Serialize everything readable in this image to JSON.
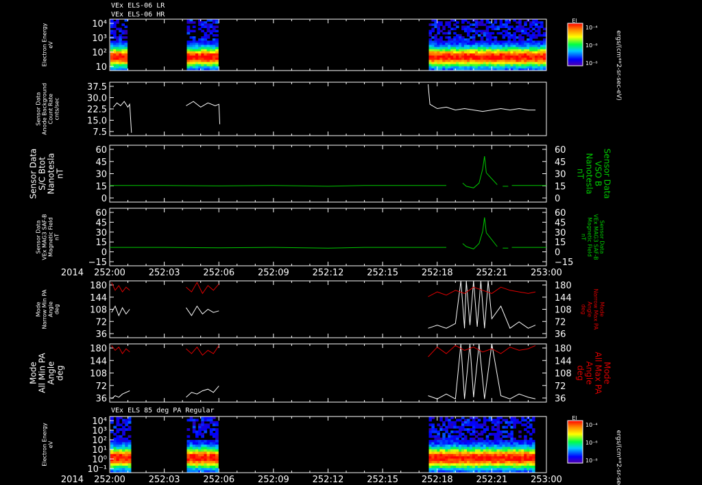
{
  "header": {
    "line1": "VEx ELS-06 LR",
    "line2": "VEx ELS-06 HR",
    "spectrogram2_title": "VEx ELS 85 deg PA Regular"
  },
  "colors": {
    "background": "#000000",
    "white_trace": "#ffffff",
    "green_trace": "#00cc00",
    "red_trace": "#dd0000",
    "right_label_green": "#00cc00",
    "right_label_red": "#dd0000"
  },
  "colorbars": [
    {
      "title": "El",
      "ticks": [
        "10⁻⁴",
        "10⁻⁶",
        "10⁻⁸"
      ],
      "unit": "ergs/(cm**2-sr-sec-eV)"
    },
    {
      "title": "El",
      "ticks": [
        "10⁻⁴",
        "10⁻⁶",
        "10⁻⁸"
      ],
      "unit": "ergs/(cm**2-sr-sec-eV)"
    }
  ],
  "x_axis": {
    "year_label": "2014",
    "ticks": [
      "252:00",
      "252:03",
      "252:06",
      "252:09",
      "252:12",
      "252:15",
      "252:18",
      "252:21",
      "253:00"
    ]
  },
  "chart_data": [
    {
      "type": "heatmap",
      "name": "electron-energy-spectrogram-1",
      "ylabel": [
        "Electron Energy",
        "eV"
      ],
      "yscale": "log",
      "yticks": [
        "10⁴",
        "10³",
        "10²",
        "10"
      ],
      "data_intervals_min": [
        [
          0,
          1.0
        ],
        [
          4.2,
          6.0
        ],
        [
          17.5,
          24
        ]
      ],
      "x_range_min": [
        0,
        24
      ]
    },
    {
      "type": "line",
      "name": "anode-background",
      "ylabel": [
        "Sensor Data",
        "Anode Background",
        "Count Rate",
        "cnts/sec"
      ],
      "yticks": [
        "37.5",
        "30.0",
        "22.5",
        "15.0",
        "7.5"
      ],
      "ylim": [
        0,
        37.5
      ],
      "series": [
        {
          "segments": [
            {
              "x": [
                0.2,
                0.4,
                0.6,
                0.8,
                1.0,
                1.1,
                1.2
              ],
              "y": [
                20,
                23,
                21,
                24,
                20,
                22,
                2
              ]
            },
            {
              "x": [
                4.2,
                4.6,
                5.0,
                5.4,
                5.8,
                6.0,
                6.05
              ],
              "y": [
                21,
                24,
                20,
                23,
                21,
                22,
                8
              ]
            },
            {
              "x": [
                17.5,
                17.6,
                18.0,
                18.5,
                19.0,
                19.5,
                20.0,
                20.5,
                21.0,
                21.5,
                22.0,
                22.5,
                23.0,
                23.4
              ],
              "y": [
                36,
                22,
                19,
                20,
                18,
                19,
                18,
                17,
                18,
                19,
                18,
                19,
                18,
                18
              ]
            }
          ]
        }
      ]
    },
    {
      "type": "line",
      "name": "sc-btot",
      "ylabel": [
        "Sensor Data",
        "S/C Btot",
        "Nanotesla",
        "nT"
      ],
      "yticks": [
        "60",
        "45",
        "30",
        "15",
        "0"
      ],
      "ylim": [
        -12,
        60
      ],
      "right_label": [
        "Sensor Data",
        "VSO B",
        "Nanotesla",
        "nT"
      ],
      "series": [
        {
          "segments": [
            {
              "x": [
                0,
                3,
                6,
                9,
                12,
                14,
                16,
                18.5
              ],
              "y": [
                9,
                9,
                8.5,
                9,
                8,
                9,
                9,
                9
              ]
            },
            {
              "x": [
                19.4,
                19.6,
                20.0,
                20.3,
                20.5,
                20.6,
                20.7
              ],
              "y": [
                12,
                8,
                6,
                12,
                30,
                46,
                25
              ]
            },
            {
              "x": [
                20.7,
                21.3
              ],
              "y": [
                25,
                10
              ]
            },
            {
              "x": [
                21.6,
                21.9
              ],
              "y": [
                8,
                8
              ]
            },
            {
              "x": [
                22.1,
                24
              ],
              "y": [
                9,
                9
              ]
            }
          ]
        }
      ]
    },
    {
      "type": "line",
      "name": "magnetic-field",
      "ylabel": [
        "Sensor Data",
        "VEx MAG3 SAF-B",
        "Magnetic Field",
        "nT"
      ],
      "yticks": [
        "60",
        "45",
        "30",
        "15",
        "0",
        "−15"
      ],
      "ylim": [
        -15,
        60
      ],
      "right_label": [
        "Sensor Data",
        "VEx MAG3 SAF-B",
        "Magnetic Field",
        "nT"
      ],
      "series": [
        {
          "segments": [
            {
              "x": [
                0,
                3,
                6,
                9,
                12,
                14,
                16,
                18.5
              ],
              "y": [
                9,
                9,
                8.5,
                9,
                8,
                9,
                9,
                9
              ]
            },
            {
              "x": [
                19.4,
                19.6,
                20.0,
                20.3,
                20.5,
                20.6,
                20.7
              ],
              "y": [
                14,
                10,
                7,
                14,
                30,
                48,
                28
              ]
            },
            {
              "x": [
                20.7,
                21.3
              ],
              "y": [
                28,
                10
              ]
            },
            {
              "x": [
                21.6,
                21.9
              ],
              "y": [
                8,
                8
              ]
            },
            {
              "x": [
                22.1,
                24
              ],
              "y": [
                9,
                9
              ]
            }
          ]
        }
      ]
    },
    {
      "type": "line",
      "name": "narrow-pa",
      "ylabel": [
        "Mode",
        "Narrow Min PA",
        "Angle",
        "deg"
      ],
      "yticks": [
        "180",
        "144",
        "108",
        "72",
        "36"
      ],
      "ylim": [
        0,
        180
      ],
      "right_label": [
        "Mode",
        "Narrow Max PA",
        "Angle",
        "deg"
      ],
      "series": [
        {
          "name": "min",
          "segments": [
            {
              "x": [
                0.1,
                0.3,
                0.5,
                0.7,
                0.9,
                1.1
              ],
              "y": [
                80,
                100,
                70,
                95,
                75,
                90
              ]
            },
            {
              "x": [
                4.2,
                4.5,
                4.8,
                5.1,
                5.4,
                5.7,
                6.0
              ],
              "y": [
                95,
                70,
                100,
                75,
                90,
                80,
                85
              ]
            },
            {
              "x": [
                17.5,
                18.0,
                18.5,
                19.0,
                19.3,
                19.5,
                19.6,
                19.8,
                20.0,
                20.2,
                20.4,
                20.6,
                20.8,
                21.0,
                21.5,
                22.0,
                22.5,
                23.0,
                23.4
              ],
              "y": [
                30,
                40,
                30,
                45,
                180,
                30,
                180,
                40,
                180,
                35,
                180,
                30,
                180,
                60,
                100,
                30,
                50,
                30,
                40
              ]
            }
          ]
        },
        {
          "name": "max",
          "segments": [
            {
              "x": [
                0.1,
                0.3,
                0.5,
                0.7,
                0.9,
                1.1
              ],
              "y": [
                175,
                150,
                165,
                145,
                160,
                150
              ]
            },
            {
              "x": [
                4.2,
                4.5,
                4.8,
                5.1,
                5.4,
                5.7,
                6.0
              ],
              "y": [
                160,
                145,
                175,
                140,
                165,
                150,
                170
              ]
            },
            {
              "x": [
                17.5,
                18.0,
                18.5,
                19.0,
                19.5,
                20.0,
                20.5,
                21.0,
                21.5,
                22.0,
                22.5,
                23.0,
                23.4
              ],
              "y": [
                130,
                145,
                135,
                150,
                140,
                160,
                150,
                140,
                160,
                150,
                145,
                140,
                145
              ]
            }
          ]
        }
      ]
    },
    {
      "type": "line",
      "name": "all-pa",
      "ylabel": [
        "Mode",
        "All Min PA",
        "Angle",
        "deg"
      ],
      "yticks": [
        "180",
        "144",
        "108",
        "72",
        "36"
      ],
      "ylim": [
        0,
        180
      ],
      "right_label": [
        "Mode",
        "All Max PA",
        "Angle",
        "deg"
      ],
      "series": [
        {
          "name": "min",
          "segments": [
            {
              "x": [
                0.1,
                0.3,
                0.5,
                0.7,
                0.9,
                1.1
              ],
              "y": [
                10,
                20,
                15,
                25,
                30,
                35
              ]
            },
            {
              "x": [
                4.2,
                4.5,
                4.8,
                5.1,
                5.4,
                5.7,
                6.0
              ],
              "y": [
                15,
                30,
                25,
                35,
                40,
                30,
                50
              ]
            },
            {
              "x": [
                17.5,
                18.0,
                18.5,
                19.0,
                19.3,
                19.5,
                19.8,
                20.0,
                20.3,
                20.6,
                21.0,
                21.5,
                22.0,
                22.5,
                23.0,
                23.4
              ],
              "y": [
                20,
                10,
                25,
                10,
                180,
                10,
                180,
                15,
                180,
                10,
                180,
                20,
                10,
                25,
                15,
                10
              ]
            }
          ]
        },
        {
          "name": "max",
          "segments": [
            {
              "x": [
                0.1,
                0.3,
                0.5,
                0.7,
                0.9,
                1.1
              ],
              "y": [
                175,
                160,
                170,
                150,
                165,
                155
              ]
            },
            {
              "x": [
                4.2,
                4.5,
                4.8,
                5.1,
                5.4,
                5.7,
                6.0
              ],
              "y": [
                165,
                150,
                170,
                145,
                160,
                150,
                175
              ]
            },
            {
              "x": [
                17.5,
                18.0,
                18.5,
                19.0,
                19.5,
                20.0,
                20.5,
                21.0,
                21.5,
                22.0,
                22.5,
                23.0,
                23.4
              ],
              "y": [
                140,
                170,
                150,
                175,
                160,
                170,
                155,
                165,
                150,
                170,
                160,
                165,
                175
              ]
            }
          ]
        }
      ]
    },
    {
      "type": "heatmap",
      "name": "electron-energy-spectrogram-2",
      "ylabel": [
        "Electron Energy",
        "eV"
      ],
      "yscale": "log",
      "yticks": [
        "10⁴",
        "10³",
        "10²",
        "10¹",
        "10⁰",
        "10⁻¹"
      ],
      "data_intervals_min": [
        [
          0,
          1.2
        ],
        [
          4.2,
          6.0
        ],
        [
          17.5,
          23.4
        ]
      ],
      "x_range_min": [
        0,
        24
      ]
    }
  ]
}
